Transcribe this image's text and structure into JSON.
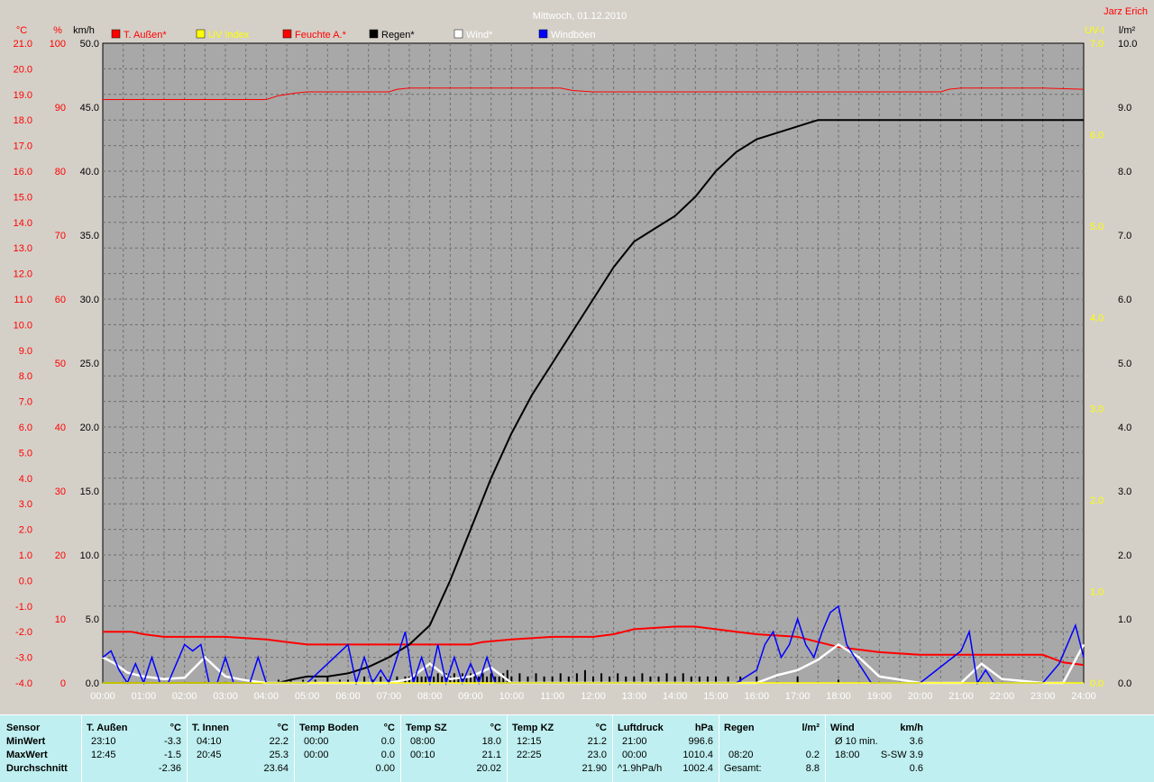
{
  "title": "Mittwoch, 01.12.2010",
  "author": "Jarz Erich",
  "colors": {
    "background": "#a8a8a8",
    "grid": "#6e6e6e",
    "temp": "#ff0000",
    "humidity": "#ff0000",
    "uv": "#ffff00",
    "rain": "#000000",
    "wind": "#ffffff",
    "gust": "#0000ff",
    "table_bg": "#bfeff0"
  },
  "legend": [
    {
      "label": "T. Außen*",
      "color": "#ff0000",
      "text_color": "#ff0000",
      "icon": "red-square-icon"
    },
    {
      "label": "UV Index",
      "color": "#ffff00",
      "text_color": "#ffff00",
      "icon": "yellow-square-icon"
    },
    {
      "label": "Feuchte A.*",
      "color": "#ff0000",
      "text_color": "#ff0000",
      "icon": "red-square-icon"
    },
    {
      "label": "Regen*",
      "color": "#000000",
      "text_color": "#000000",
      "icon": "black-square-icon"
    },
    {
      "label": "Wind*",
      "color": "#ffffff",
      "text_color": "#ffffff",
      "icon": "white-square-icon"
    },
    {
      "label": "Windböen",
      "color": "#0000ff",
      "text_color": "#ffffff",
      "icon": "blue-square-icon"
    }
  ],
  "axes": {
    "temp": {
      "unit": "°C",
      "ticks": [
        "21.0",
        "20.0",
        "19.0",
        "18.0",
        "17.0",
        "16.0",
        "15.0",
        "14.0",
        "13.0",
        "12.0",
        "11.0",
        "10.0",
        "9.0",
        "8.0",
        "7.0",
        "6.0",
        "5.0",
        "4.0",
        "3.0",
        "2.0",
        "1.0",
        "0.0",
        "-1.0",
        "-2.0",
        "-3.0",
        "-4.0"
      ],
      "range": [
        -4,
        21
      ]
    },
    "humidity": {
      "unit": "%",
      "ticks": [
        "100",
        "90",
        "80",
        "70",
        "60",
        "50",
        "40",
        "30",
        "20",
        "10",
        "0"
      ],
      "range": [
        0,
        100
      ]
    },
    "wind": {
      "unit": "km/h",
      "ticks": [
        "50.0",
        "45.0",
        "40.0",
        "35.0",
        "30.0",
        "25.0",
        "20.0",
        "15.0",
        "10.0",
        "5.0",
        "0.0"
      ],
      "range": [
        0,
        50
      ]
    },
    "uv": {
      "unit": "UV-I",
      "ticks": [
        "7.0",
        "6.0",
        "5.0",
        "4.0",
        "3.0",
        "2.0",
        "1.0",
        "0.0"
      ],
      "range": [
        0,
        7
      ]
    },
    "rain": {
      "unit": "l/m²",
      "ticks": [
        "10.0",
        "9.0",
        "8.0",
        "7.0",
        "6.0",
        "5.0",
        "4.0",
        "3.0",
        "2.0",
        "1.0",
        "0.0"
      ],
      "range": [
        0,
        10
      ]
    },
    "x": {
      "ticks": [
        "00:00",
        "01:00",
        "02:00",
        "03:00",
        "04:00",
        "05:00",
        "06:00",
        "07:00",
        "08:00",
        "09:00",
        "10:00",
        "11:00",
        "12:00",
        "13:00",
        "14:00",
        "15:00",
        "16:00",
        "17:00",
        "18:00",
        "19:00",
        "20:00",
        "21:00",
        "22:00",
        "23:00",
        "24:00"
      ],
      "range": [
        0,
        24
      ]
    }
  },
  "chart_data": {
    "type": "line",
    "title": "Mittwoch, 01.12.2010",
    "x_unit": "hour",
    "grid": true,
    "legend_position": "top",
    "series": [
      {
        "name": "T. Außen*",
        "axis": "temp",
        "color": "#ff0000",
        "x": [
          0,
          0.7,
          1.0,
          1.5,
          3.0,
          4.0,
          4.5,
          5.0,
          6.0,
          7.0,
          8.0,
          9.0,
          9.3,
          10.0,
          11.0,
          12.0,
          12.5,
          13.0,
          14.0,
          14.5,
          15.0,
          15.5,
          16.0,
          17.0,
          18.0,
          19.0,
          20.0,
          21.0,
          22.0,
          23.0,
          23.5,
          24.0
        ],
        "y": [
          -2.0,
          -2.0,
          -2.1,
          -2.2,
          -2.2,
          -2.3,
          -2.4,
          -2.5,
          -2.5,
          -2.5,
          -2.5,
          -2.5,
          -2.4,
          -2.3,
          -2.2,
          -2.2,
          -2.1,
          -1.9,
          -1.8,
          -1.8,
          -1.9,
          -2.0,
          -2.1,
          -2.2,
          -2.6,
          -2.8,
          -2.9,
          -2.9,
          -2.9,
          -2.9,
          -3.2,
          -3.3
        ]
      },
      {
        "name": "Feuchte A.*",
        "axis": "humidity",
        "color": "#ff0000",
        "x": [
          0,
          1,
          2,
          3,
          4.0,
          4.3,
          4.7,
          5.0,
          6.0,
          7.0,
          7.2,
          7.5,
          8.0,
          9.0,
          10.0,
          11.0,
          11.2,
          11.5,
          12.0,
          13.0,
          14.0,
          15.0,
          16.0,
          17.0,
          18.0,
          19.0,
          20.0,
          20.5,
          20.7,
          21.0,
          22.0,
          23.0,
          24.0
        ],
        "y": [
          91.2,
          91.2,
          91.2,
          91.2,
          91.2,
          91.8,
          92.2,
          92.4,
          92.4,
          92.4,
          92.8,
          93.0,
          93.0,
          93.0,
          93.0,
          93.0,
          93.0,
          92.6,
          92.4,
          92.4,
          92.4,
          92.4,
          92.4,
          92.4,
          92.4,
          92.4,
          92.4,
          92.4,
          92.8,
          93.0,
          93.0,
          93.0,
          92.8
        ]
      },
      {
        "name": "Regen*",
        "axis": "rain",
        "color": "#000000",
        "x": [
          0,
          4.3,
          4.6,
          5.0,
          5.5,
          6.0,
          6.5,
          7.0,
          7.5,
          8.0,
          8.5,
          9.0,
          9.5,
          10.0,
          10.5,
          11.0,
          11.5,
          12.0,
          12.5,
          13.0,
          13.5,
          14.0,
          14.5,
          15.0,
          15.5,
          16.0,
          16.5,
          17.0,
          17.5,
          18.0,
          19.0,
          20.0,
          21.0,
          22.0,
          23.0,
          24.0
        ],
        "y": [
          0,
          0,
          0.05,
          0.1,
          0.1,
          0.15,
          0.25,
          0.4,
          0.6,
          0.9,
          1.6,
          2.4,
          3.2,
          3.9,
          4.5,
          5.0,
          5.5,
          6.0,
          6.5,
          6.9,
          7.1,
          7.3,
          7.6,
          8.0,
          8.3,
          8.5,
          8.6,
          8.7,
          8.8,
          8.8,
          8.8,
          8.8,
          8.8,
          8.8,
          8.8,
          8.8
        ]
      },
      {
        "name": "Wind*",
        "axis": "wind",
        "color": "#ffffff",
        "x": [
          0,
          0.3,
          0.6,
          1.0,
          1.5,
          2.0,
          2.5,
          3.0,
          3.5,
          4.0,
          4.5,
          5.0,
          7.0,
          7.5,
          8.0,
          8.5,
          9.0,
          9.5,
          10.0,
          15.0,
          16.0,
          16.5,
          17.0,
          17.5,
          18.0,
          18.5,
          19.0,
          20.0,
          21.0,
          21.5,
          22.0,
          23.0,
          23.5,
          24.0
        ],
        "y": [
          2.0,
          1.5,
          0.8,
          0.5,
          0.3,
          0.4,
          2.0,
          0.5,
          0.2,
          0.0,
          0.0,
          0.0,
          0.0,
          0.3,
          1.5,
          0.3,
          0.5,
          1.2,
          0.0,
          0.0,
          0.0,
          0.6,
          1.0,
          1.8,
          3.0,
          2.0,
          0.5,
          0.0,
          0.0,
          1.5,
          0.3,
          0.0,
          0.0,
          3.0
        ]
      },
      {
        "name": "Windböen",
        "axis": "wind",
        "color": "#0000ff",
        "x": [
          0,
          0.2,
          0.4,
          0.6,
          0.8,
          1.0,
          1.2,
          1.4,
          1.6,
          2.0,
          2.2,
          2.4,
          2.6,
          2.8,
          3.0,
          3.2,
          3.4,
          3.6,
          3.8,
          4.0,
          4.3,
          4.6,
          5.0,
          6.0,
          6.2,
          6.4,
          6.6,
          6.8,
          7.0,
          7.2,
          7.4,
          7.6,
          7.8,
          8.0,
          8.2,
          8.4,
          8.6,
          8.8,
          9.0,
          9.2,
          9.4,
          9.6,
          10.0,
          15.5,
          16.0,
          16.2,
          16.4,
          16.6,
          16.8,
          17.0,
          17.2,
          17.4,
          17.6,
          17.8,
          18.0,
          18.2,
          18.4,
          18.6,
          18.8,
          19.0,
          20.0,
          21.0,
          21.2,
          21.4,
          21.6,
          21.8,
          22.0,
          22.5,
          23.0,
          23.4,
          23.6,
          23.8,
          24.0
        ],
        "y": [
          2.0,
          2.5,
          1.0,
          0.0,
          1.5,
          0.0,
          2.0,
          0.0,
          0.0,
          3.0,
          2.5,
          3.0,
          0.0,
          0.0,
          2.0,
          0.0,
          0.0,
          0.0,
          2.0,
          0.0,
          0.0,
          0.0,
          0.0,
          3.0,
          0.0,
          2.0,
          0.0,
          1.0,
          0.0,
          2.0,
          4.0,
          0.0,
          2.0,
          0.0,
          3.0,
          0.0,
          2.0,
          0.0,
          1.5,
          0.0,
          2.0,
          0.0,
          0.0,
          0.0,
          1.0,
          3.0,
          4.0,
          2.0,
          3.0,
          5.0,
          3.0,
          2.0,
          4.0,
          5.5,
          6.0,
          3.0,
          2.0,
          1.0,
          0.0,
          0.0,
          0.0,
          2.5,
          4.0,
          0.0,
          1.0,
          0.0,
          0.0,
          0.0,
          0.0,
          1.5,
          3.0,
          4.5,
          2.0
        ]
      },
      {
        "name": "UV Index",
        "axis": "uv",
        "color": "#ffff00",
        "x": [
          0,
          24
        ],
        "y": [
          0,
          0
        ]
      }
    ],
    "rain_bars": {
      "axis": "rain",
      "x": [
        4.3,
        4.6,
        4.9,
        5.2,
        5.5,
        5.8,
        6.0,
        6.2,
        6.4,
        6.6,
        6.8,
        7.0,
        7.2,
        7.4,
        7.5,
        7.6,
        7.7,
        7.8,
        7.9,
        8.0,
        8.1,
        8.2,
        8.3,
        8.4,
        8.5,
        8.6,
        8.7,
        8.8,
        8.9,
        9.0,
        9.1,
        9.2,
        9.3,
        9.4,
        9.5,
        9.6,
        9.7,
        9.8,
        9.9,
        10.0,
        10.2,
        10.4,
        10.6,
        10.8,
        11.0,
        11.2,
        11.4,
        11.6,
        11.8,
        12.0,
        12.2,
        12.4,
        12.6,
        12.8,
        13.0,
        13.2,
        13.4,
        13.6,
        13.8,
        14.0,
        14.2,
        14.4,
        14.6,
        14.8,
        15.0,
        15.3,
        15.6,
        16.0,
        17.0,
        18.0
      ],
      "y": [
        0.05,
        0.05,
        0.05,
        0.05,
        0.1,
        0.05,
        0.05,
        0.05,
        0.1,
        0.05,
        0.1,
        0.05,
        0.1,
        0.1,
        0.1,
        0.1,
        0.1,
        0.1,
        0.1,
        0.1,
        0.1,
        0.15,
        0.1,
        0.15,
        0.1,
        0.15,
        0.1,
        0.15,
        0.1,
        0.15,
        0.15,
        0.1,
        0.15,
        0.1,
        0.15,
        0.1,
        0.1,
        0.15,
        0.2,
        0.1,
        0.15,
        0.1,
        0.15,
        0.1,
        0.1,
        0.15,
        0.1,
        0.15,
        0.2,
        0.1,
        0.15,
        0.1,
        0.15,
        0.1,
        0.1,
        0.15,
        0.1,
        0.1,
        0.15,
        0.1,
        0.15,
        0.1,
        0.1,
        0.1,
        0.1,
        0.1,
        0.1,
        0.1,
        0.1,
        0.05
      ]
    }
  },
  "stats": {
    "row_labels": [
      "Sensor",
      "MinWert",
      "MaxWert",
      "Durchschnitt"
    ],
    "columns": [
      {
        "title": "T. Außen",
        "unit": "°C",
        "min_time": "23:10",
        "min": "-3.3",
        "max_time": "12:45",
        "max": "-1.5",
        "avg": "-2.36"
      },
      {
        "title": "T. Innen",
        "unit": "°C",
        "min_time": "04:10",
        "min": "22.2",
        "max_time": "20:45",
        "max": "25.3",
        "avg": "23.64"
      },
      {
        "title": "Temp Boden",
        "unit": "°C",
        "min_time": "00:00",
        "min": "0.0",
        "max_time": "00:00",
        "max": "0.0",
        "avg": "0.00"
      },
      {
        "title": "Temp SZ",
        "unit": "°C",
        "min_time": "08:00",
        "min": "18.0",
        "max_time": "00:10",
        "max": "21.1",
        "avg": "20.02"
      },
      {
        "title": "Temp KZ",
        "unit": "°C",
        "min_time": "12:15",
        "min": "21.2",
        "max_time": "22:25",
        "max": "23.0",
        "avg": "21.90"
      },
      {
        "title": "Luftdruck",
        "unit": "hPa",
        "min_time": "21:00",
        "min": "996.6",
        "max_time": "00:00",
        "max": "1010.4",
        "avg_label": "^1.9hPa/h",
        "avg": "1002.4"
      },
      {
        "title": "Regen",
        "unit": "l/m²",
        "min_time": "",
        "min": "",
        "max_time": "08:20",
        "max": "0.2",
        "avg_label": "Gesamt:",
        "avg": "8.8"
      },
      {
        "title": "Wind",
        "unit": "km/h",
        "min_time": "Ø 10 min.",
        "min": "3.6",
        "max_time": "18:00",
        "max": "S-SW 3.9",
        "avg": "0.6"
      }
    ]
  }
}
